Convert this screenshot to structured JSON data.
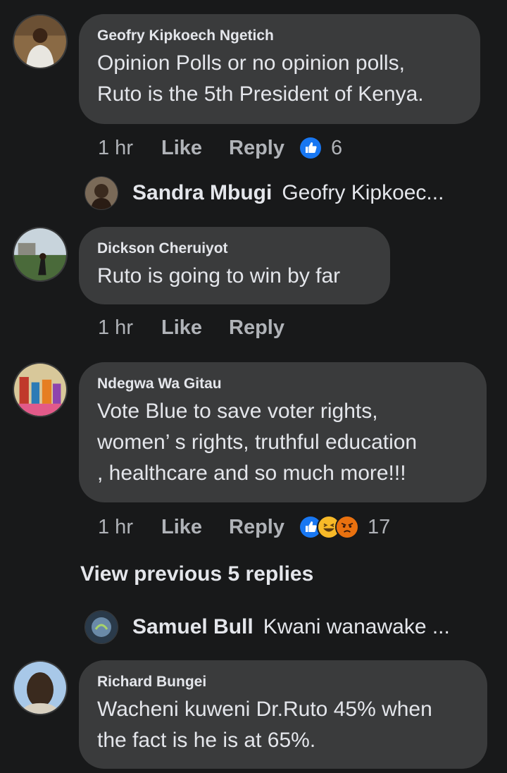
{
  "comments": [
    {
      "author": "Geofry Kipkoech Ngetich",
      "text": "Opinion Polls or no opinion polls,\nRuto is the 5th President of Kenya.",
      "time": "1 hr",
      "like": "Like",
      "reply": "Reply",
      "reaction_count": "6"
    },
    {
      "author": "Dickson Cheruiyot",
      "text": "Ruto is going to win by far",
      "time": "1 hr",
      "like": "Like",
      "reply": "Reply"
    },
    {
      "author": "Ndegwa Wa Gitau",
      "text": "Vote Blue to save voter rights,\nwomen’ s rights, truthful education\n, healthcare and so much more!!!",
      "time": "1 hr",
      "like": "Like",
      "reply": "Reply",
      "reaction_count": "17"
    },
    {
      "author": "Richard Bungei",
      "text": "Wacheni kuweni Dr.Ruto 45% when\nthe fact is he is at 65%."
    }
  ],
  "replies": [
    {
      "name": "Sandra Mbugi",
      "snippet": "Geofry Kipkoec..."
    },
    {
      "name": "Samuel Bull",
      "snippet": "Kwani wanawake ..."
    }
  ],
  "view_previous": "View previous 5 replies",
  "colors": {
    "background": "#18191a",
    "bubble": "#3a3b3c",
    "text": "#e4e6eb",
    "secondary": "#b0b3b8",
    "like_blue": "#1877f2",
    "haha_yellow": "#f7b928",
    "angry_orange": "#e9710f"
  }
}
